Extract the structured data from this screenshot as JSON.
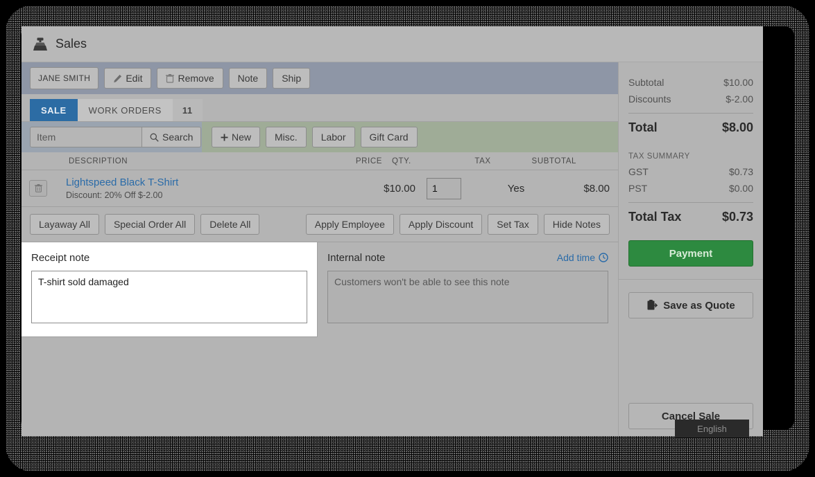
{
  "window": {
    "title": "Sales",
    "title_icon": "cash-register-icon"
  },
  "customer_bar": {
    "customer_name": "JANE SMITH",
    "edit_label": "Edit",
    "remove_label": "Remove",
    "note_label": "Note",
    "ship_label": "Ship"
  },
  "tabs": [
    {
      "label": "SALE",
      "active": true
    },
    {
      "label": "WORK ORDERS",
      "active": false
    }
  ],
  "tab_count": "11",
  "search": {
    "value": "",
    "placeholder": "Item",
    "button_label": "Search"
  },
  "quick_add": [
    {
      "label": "New",
      "icon": "plus-icon"
    },
    {
      "label": "Misc.",
      "icon": ""
    },
    {
      "label": "Labor",
      "icon": ""
    },
    {
      "label": "Gift Card",
      "icon": ""
    }
  ],
  "table": {
    "headers": {
      "description": "DESCRIPTION",
      "price": "PRICE",
      "qty": "QTY.",
      "tax": "TAX",
      "subtotal": "SUBTOTAL"
    },
    "rows": [
      {
        "name": "Lightspeed Black T-Shirt",
        "discount": "Discount: 20% Off $-2.00",
        "price": "$10.00",
        "qty": "1",
        "tax": "Yes",
        "subtotal": "$8.00"
      }
    ]
  },
  "actions": {
    "left": [
      "Layaway All",
      "Special Order All",
      "Delete All"
    ],
    "right": [
      "Apply Employee",
      "Apply Discount",
      "Set Tax",
      "Hide Notes"
    ]
  },
  "notes": {
    "receipt": {
      "label": "Receipt note",
      "value": "T-shirt sold damaged",
      "placeholder": ""
    },
    "internal": {
      "label": "Internal note",
      "value": "",
      "placeholder": "Customers won't be able to see this note",
      "add_time_label": "Add time"
    }
  },
  "summary": {
    "subtotal_label": "Subtotal",
    "subtotal_value": "$10.00",
    "discounts_label": "Discounts",
    "discounts_value": "$-2.00",
    "total_label": "Total",
    "total_value": "$8.00",
    "tax_summary_label": "TAX SUMMARY",
    "taxes": [
      {
        "label": "GST",
        "value": "$0.73"
      },
      {
        "label": "PST",
        "value": "$0.00"
      }
    ],
    "total_tax_label": "Total Tax",
    "total_tax_value": "$0.73"
  },
  "buttons": {
    "payment": "Payment",
    "save_as_quote": "Save as Quote",
    "cancel_sale": "Cancel Sale"
  },
  "language_chip": "English",
  "colors": {
    "tab_active": "#2c6ca4",
    "payment_green": "#2d8a40",
    "link_blue": "#2a6ba8",
    "customer_bar": "#8e96a6",
    "quick_add_bar": "#9fac97",
    "app_bg": "#b4b4b4"
  }
}
